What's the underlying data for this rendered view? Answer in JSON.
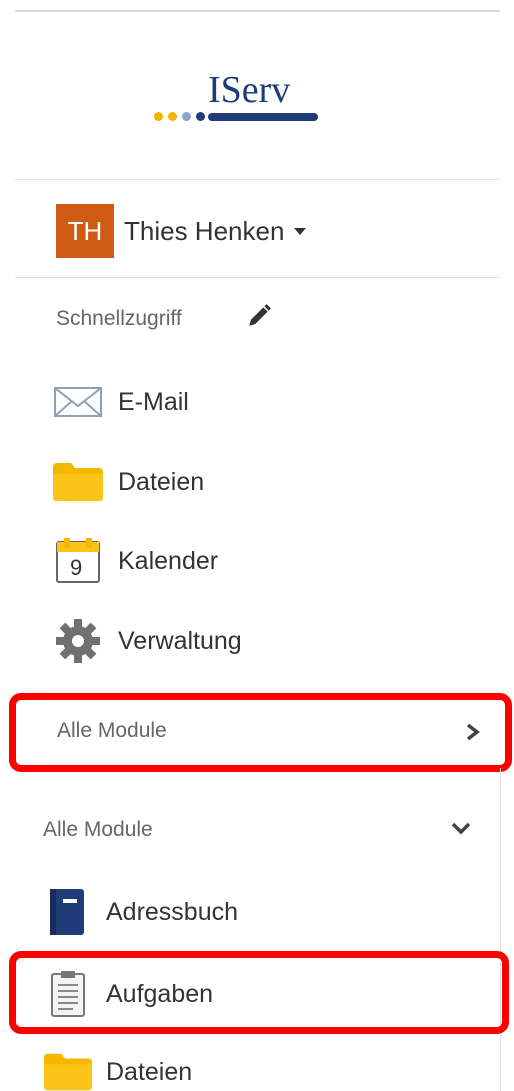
{
  "logo": {
    "text": "IServ"
  },
  "user": {
    "initials": "TH",
    "name": "Thies Henken"
  },
  "quick_access": {
    "title": "Schnellzugriff",
    "items": [
      {
        "label": "E-Mail",
        "icon": "envelope-icon"
      },
      {
        "label": "Dateien",
        "icon": "folder-icon"
      },
      {
        "label": "Kalender",
        "icon": "calendar-icon",
        "calendar_day": "9"
      },
      {
        "label": "Verwaltung",
        "icon": "gear-icon"
      }
    ]
  },
  "all_modules_link": {
    "label": "Alle Module"
  },
  "all_modules_section": {
    "title": "Alle Module",
    "items": [
      {
        "label": "Adressbuch",
        "icon": "address-book-icon"
      },
      {
        "label": "Aufgaben",
        "icon": "clipboard-icon"
      },
      {
        "label": "Dateien",
        "icon": "folder-icon"
      }
    ]
  },
  "colors": {
    "highlight": "#ff0000",
    "avatar": "#cf5a14",
    "logo": "#1f3c7a",
    "folder": "#fbc02d"
  }
}
